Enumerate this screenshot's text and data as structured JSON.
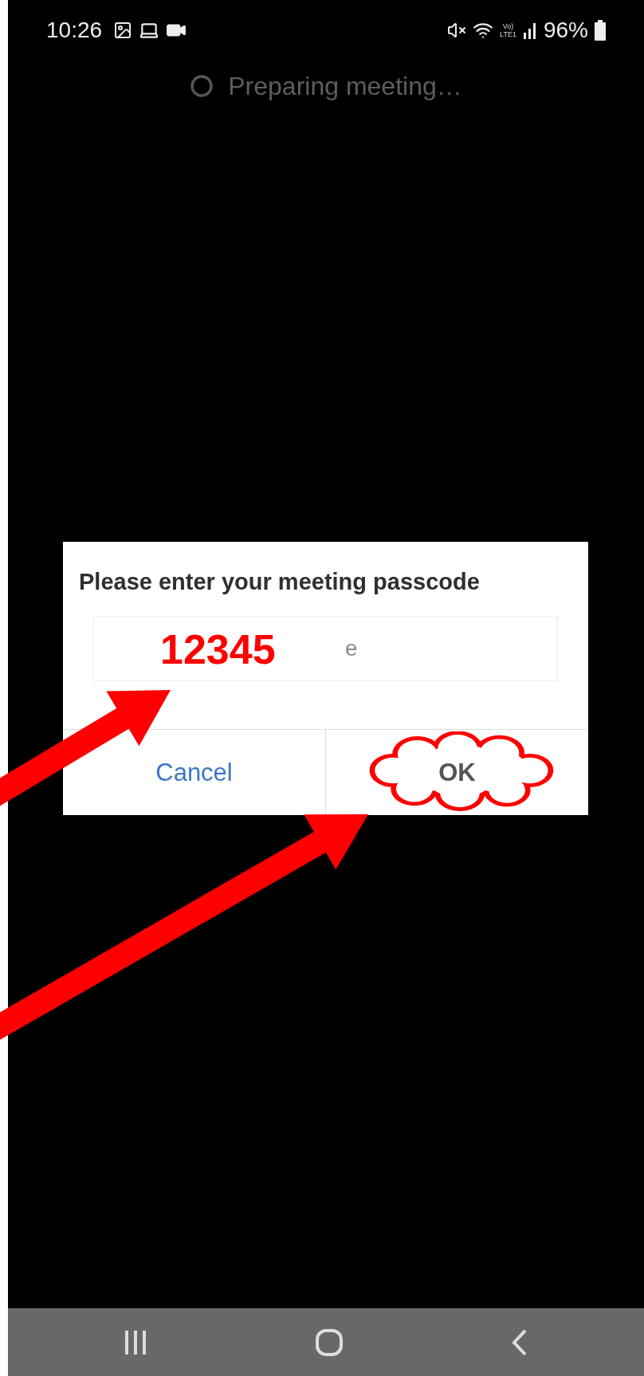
{
  "status_bar": {
    "time": "10:26",
    "volte_top": "Vo)",
    "volte_bottom": "LTE1",
    "battery": "96%"
  },
  "loading": {
    "text": "Preparing meeting…"
  },
  "dialog": {
    "title": "Please enter your meeting passcode",
    "field": {
      "placeholder": "e"
    },
    "buttons": [
      {
        "label": "Cancel",
        "kind": "secondary"
      },
      {
        "label": "OK",
        "kind": "primary"
      }
    ]
  },
  "annotation": {
    "typed_code": "12345"
  }
}
